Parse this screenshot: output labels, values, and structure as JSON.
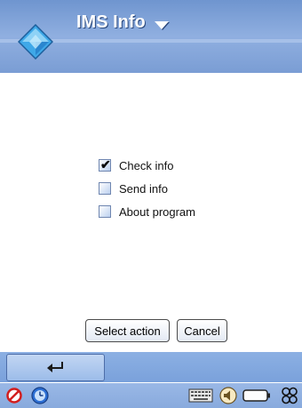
{
  "header": {
    "app_icon": "diamond-icon",
    "title": "IMS Info",
    "dropdown_icon": "chevron-down-icon",
    "colors": {
      "title_bar": "#7fa2d8",
      "text": "#ffffff"
    }
  },
  "options": [
    {
      "label": "Check info",
      "checked": true
    },
    {
      "label": "Send info",
      "checked": false
    },
    {
      "label": "About program",
      "checked": false
    }
  ],
  "buttons": {
    "select_label": "Select action",
    "cancel_label": "Cancel"
  },
  "softkey": {
    "icon": "return-arrow-icon"
  },
  "status_bar": {
    "icons": [
      "no-sign-icon",
      "clock-icon",
      "keyboard-icon",
      "volume-icon",
      "battery-icon",
      "app-grid-icon"
    ]
  }
}
